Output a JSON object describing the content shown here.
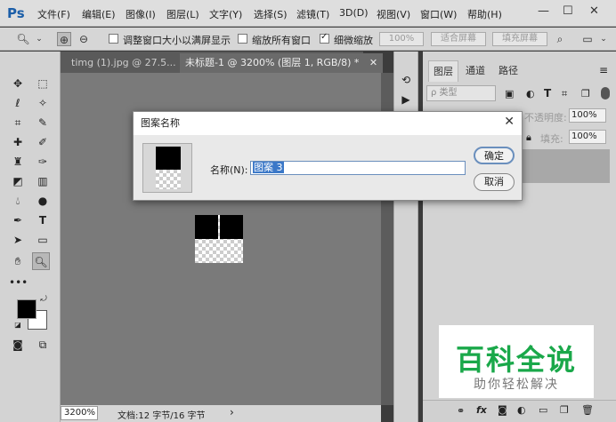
{
  "app": {
    "logo": "Ps"
  },
  "menu": [
    "文件(F)",
    "编辑(E)",
    "图像(I)",
    "图层(L)",
    "文字(Y)",
    "选择(S)",
    "滤镜(T)",
    "3D(D)",
    "视图(V)",
    "窗口(W)",
    "帮助(H)"
  ],
  "window_controls": [
    "—",
    "☐",
    "✕"
  ],
  "options": {
    "resize_windows": "调整窗口大小以满屏显示",
    "zoom_all": "缩放所有窗口",
    "scrubby_zoom": "细微缩放",
    "zoom_100": "100%",
    "fit_screen": "适合屏幕",
    "fill_screen": "填充屏幕",
    "resize_windows_checked": false,
    "zoom_all_checked": false,
    "scrubby_zoom_checked": true
  },
  "tabs": [
    {
      "label": "timg (1).jpg @ 27.5...",
      "close": "✕"
    },
    {
      "label": "未标题-1 @ 3200% (图层 1, RGB/8) *",
      "close": "✕"
    }
  ],
  "status": {
    "zoom": "3200%",
    "doc": "文档:12 字节/16 字节",
    "arrow": "›"
  },
  "panel": {
    "tabs": [
      "图层",
      "通道",
      "路径"
    ],
    "kind_label": "ρ 类型",
    "opacity_label": "不透明度:",
    "opacity_value": "100%",
    "fill_label": "填充:",
    "fill_value": "100%"
  },
  "dialog": {
    "title": "图案名称",
    "name_label": "名称(N):",
    "name_value": "图案 3",
    "ok": "确定",
    "cancel": "取消",
    "close": "✕"
  },
  "watermark": {
    "main": "百科全说",
    "sub": "助你轻松解决"
  },
  "colors": {
    "foreground": "#000000",
    "background": "#ffffff",
    "watermark_green": "#1aa84a"
  }
}
